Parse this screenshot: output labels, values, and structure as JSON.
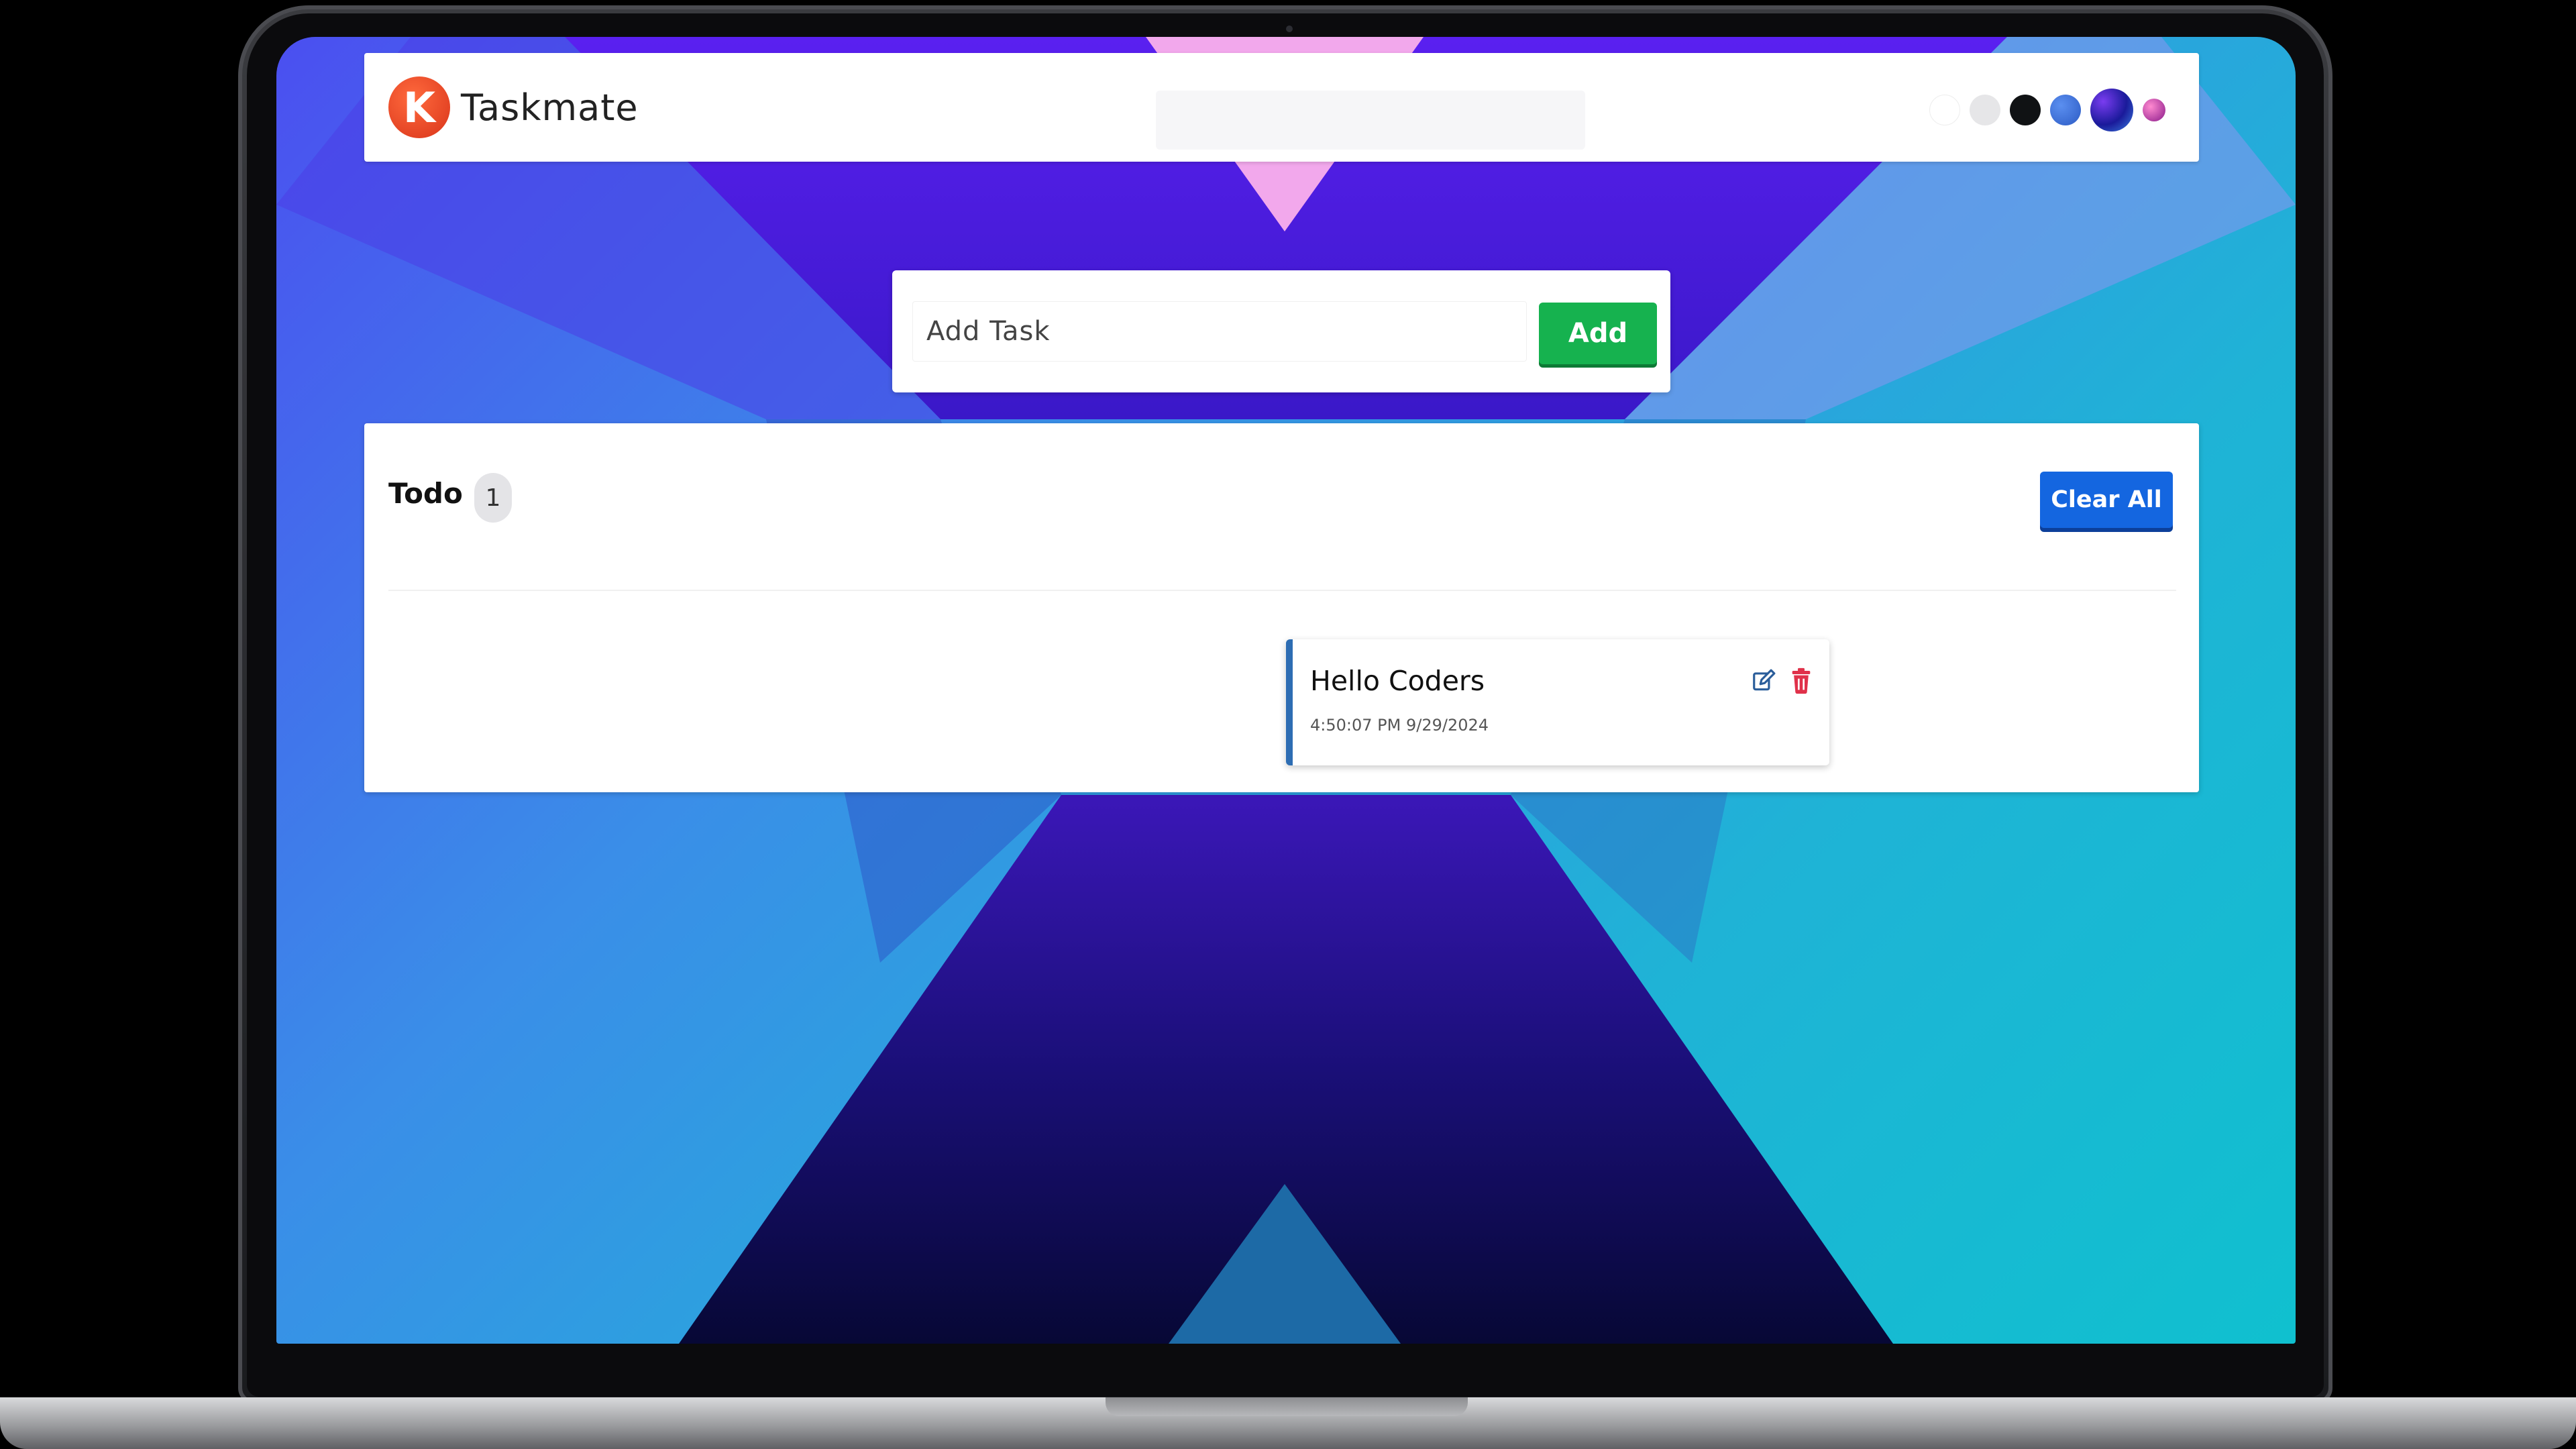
{
  "app": {
    "logo_letter": "K",
    "name": "Taskmate"
  },
  "theme_swatches": [
    {
      "name": "white",
      "color": "#ffffff"
    },
    {
      "name": "light-gray",
      "color": "#e6e6e8"
    },
    {
      "name": "black",
      "color": "#101214"
    },
    {
      "name": "blue",
      "color": "#3a6fd8"
    },
    {
      "name": "purple-gradient",
      "color": "#2a2ad0"
    },
    {
      "name": "pink-gradient",
      "color": "#e05aa8"
    }
  ],
  "add_task": {
    "placeholder": "Add Task",
    "button_label": "Add"
  },
  "todo": {
    "title": "Todo",
    "count": "1",
    "clear_label": "Clear All",
    "tasks": [
      {
        "title": "Hello Coders",
        "timestamp": "4:50:07 PM 9/29/2024"
      }
    ]
  },
  "colors": {
    "add_button": "#16b24f",
    "clear_button": "#1466e0",
    "task_accent": "#2d6db3",
    "logo": "#e23e1e"
  },
  "icons": {
    "edit": "edit-icon",
    "delete": "trash-icon"
  }
}
